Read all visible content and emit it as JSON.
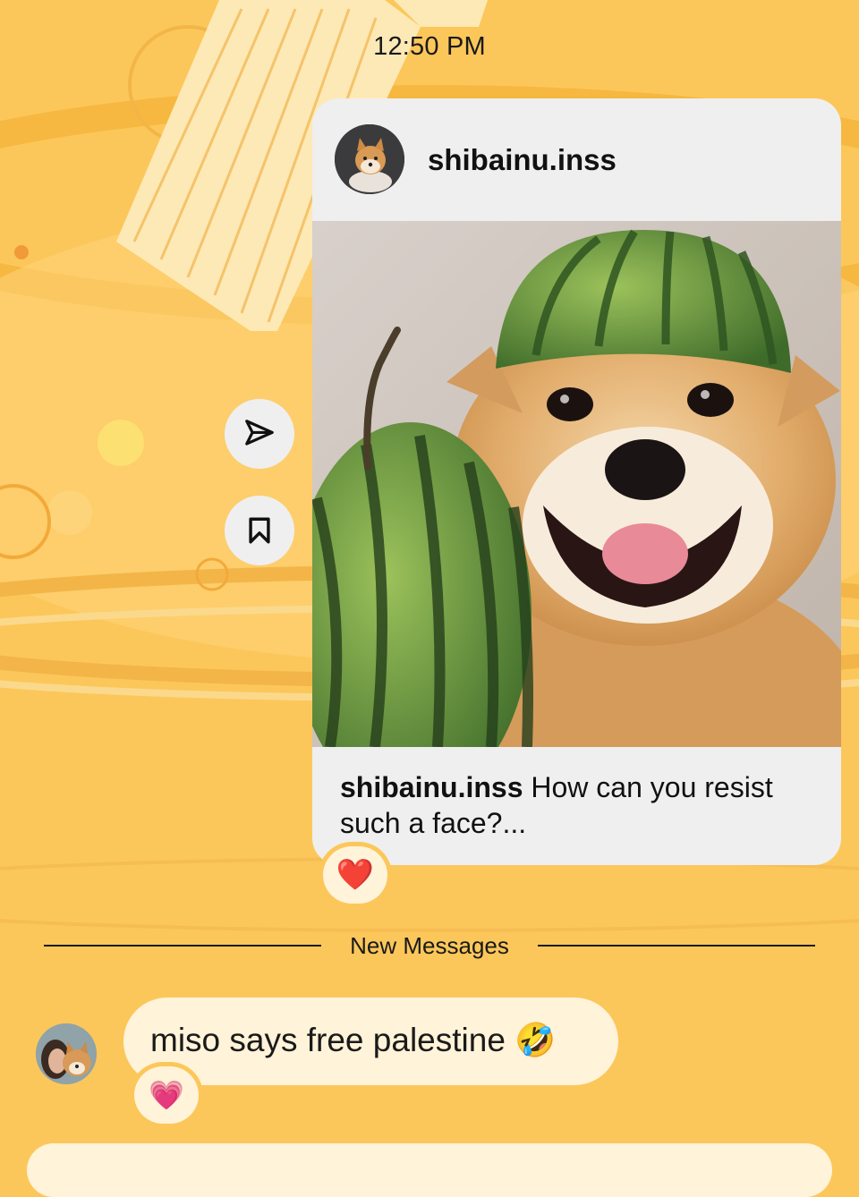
{
  "status": {
    "time": "12:50 PM"
  },
  "post": {
    "owner": "shibainu.inss",
    "caption_user": "shibainu.inss",
    "caption_text": " How can you resist such a face?...",
    "reaction": "❤️"
  },
  "actions": {
    "share_icon": "paper-plane-icon",
    "save_icon": "bookmark-icon"
  },
  "divider": {
    "label": "New Messages"
  },
  "message": {
    "text": "miso says free palestine",
    "emoji": "🤣",
    "reaction": "💗"
  },
  "colors": {
    "background": "#fcc75a",
    "bubble": "#fff3d9",
    "card": "#efefef"
  }
}
